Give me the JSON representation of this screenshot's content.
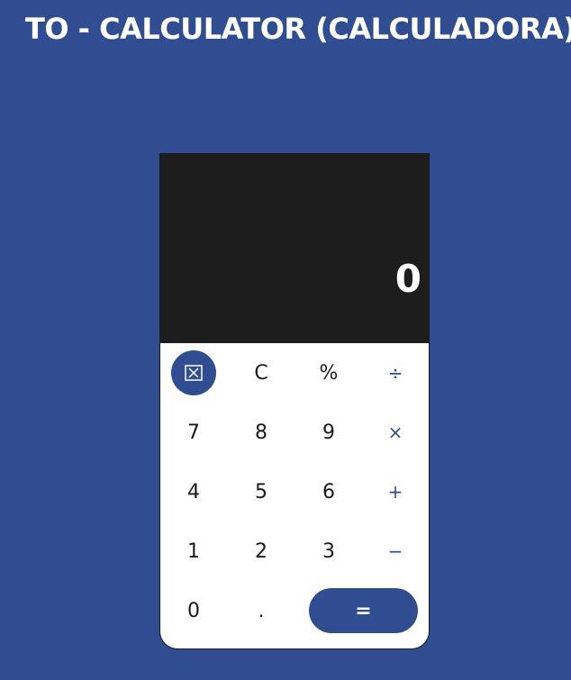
{
  "page": {
    "title": "TO - CALCULATOR (CALCULADORA)"
  },
  "display": {
    "value": "0"
  },
  "keys": {
    "backspace_icon": "backspace-icon",
    "clear": "C",
    "percent": "%",
    "divide": "÷",
    "seven": "7",
    "eight": "8",
    "nine": "9",
    "multiply": "×",
    "four": "4",
    "five": "5",
    "six": "6",
    "add": "+",
    "one": "1",
    "two": "2",
    "three": "3",
    "subtract": "−",
    "zero": "0",
    "decimal": ".",
    "equals": "="
  },
  "colors": {
    "background": "#304d91",
    "display_background": "#1d1d1d",
    "accent": "#304d91",
    "keypad_background": "#ffffff"
  }
}
